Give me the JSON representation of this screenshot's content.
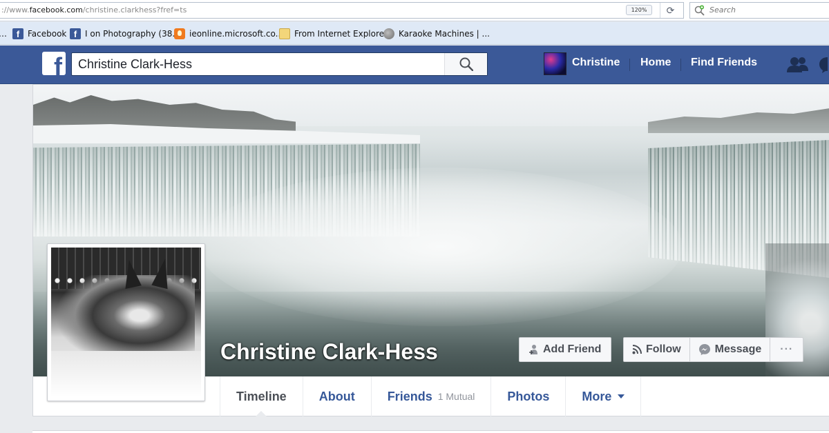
{
  "browser": {
    "url_prefix": "://www.",
    "url_domain": "facebook.com",
    "url_path": "/christine.clarkhess?fref=ts",
    "zoom": "120%",
    "search_placeholder": "Search",
    "favorites": [
      {
        "label": "Facebook",
        "icon": "facebook-icon"
      },
      {
        "label": "I on Photography (38...",
        "icon": "facebook-icon"
      },
      {
        "label": "ieonline.microsoft.co...",
        "icon": "ie-bulb-icon"
      },
      {
        "label": "From Internet Explorer",
        "icon": "folder-icon"
      },
      {
        "label": "Karaoke Machines | ...",
        "icon": "globe-icon"
      }
    ]
  },
  "topbar": {
    "logo": "f",
    "search_query": "Christine Clark-Hess",
    "user_name": "Christine",
    "nav": [
      "Home",
      "Find Friends"
    ],
    "colors": {
      "brand": "#3b5998"
    }
  },
  "profile": {
    "name": "Christine Clark-Hess",
    "buttons": {
      "add_friend": "Add Friend",
      "follow": "Follow",
      "message": "Message",
      "more": "···"
    },
    "tabs": [
      {
        "label": "Timeline",
        "sub": ""
      },
      {
        "label": "About",
        "sub": ""
      },
      {
        "label": "Friends",
        "sub": "1 Mutual"
      },
      {
        "label": "Photos",
        "sub": ""
      },
      {
        "label": "More",
        "sub": ""
      }
    ]
  }
}
